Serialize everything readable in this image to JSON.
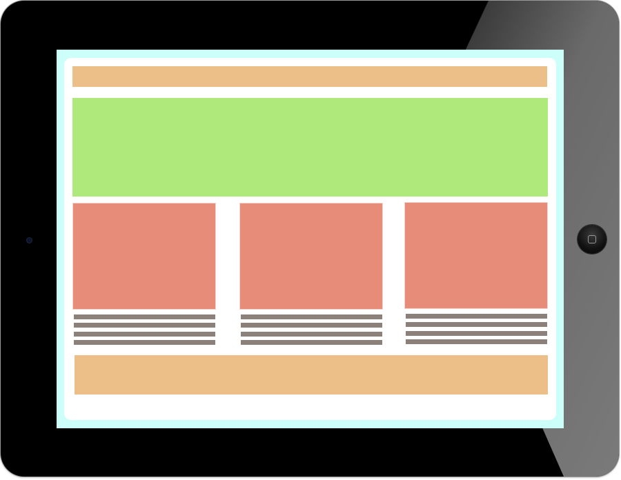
{
  "device": {
    "type": "tablet",
    "bezel_color": "#000000",
    "screen_background": "#ccfffa",
    "icons": [
      "camera-icon",
      "home-button-icon"
    ]
  },
  "wireframe": {
    "page_background": "#ffffff",
    "header_color": "#ebbf87",
    "hero_color": "#afe87b",
    "card_image_color": "#e78c79",
    "text_line_color": "#8c807a",
    "footer_color": "#ebbf87",
    "cards": [
      {
        "text_line_count": 4
      },
      {
        "text_line_count": 4
      },
      {
        "text_line_count": 4
      }
    ]
  }
}
